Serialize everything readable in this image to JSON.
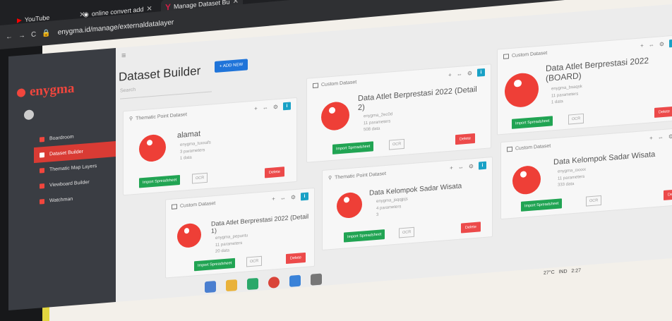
{
  "browser": {
    "tabs": [
      {
        "label": "YouTube"
      },
      {
        "label": "online convert add"
      },
      {
        "label": "Manage Dataset Bu"
      }
    ],
    "url": "enygma.id/manage/externaldatalayer"
  },
  "app": {
    "logo": "enygma",
    "sidebar": {
      "items": [
        {
          "label": "Boardroom"
        },
        {
          "label": "Dataset Builder"
        },
        {
          "label": "Thematic Map Layers"
        },
        {
          "label": "Viewboard Builder"
        },
        {
          "label": "Watchman"
        }
      ]
    },
    "page_title": "Dataset Builder",
    "add_new": "+ ADD NEW",
    "search_placeholder": "Search",
    "cards": [
      {
        "type": "Thematic Point Dataset",
        "name": "alamat",
        "m1": "enygma_tuxxafs",
        "m2": "3 parameters",
        "m3": "1 data",
        "import": "Import Spreadsheet",
        "ocr": "OCR",
        "delete": "Delete"
      },
      {
        "type": "Custom Dataset",
        "name": "Data Atlet Berprestasi 2022 (Detail 2)",
        "m1": "enygma_2ec0d",
        "m2": "11 parameters",
        "m3": "508 data",
        "import": "Import Spreadsheet",
        "ocr": "OCR",
        "delete": "Delete"
      },
      {
        "type": "Custom Dataset",
        "name": "Data Atlet Berprestasi 2022 (BOARD)",
        "m1": "enygma_bsaqsk",
        "m2": "11 parameters",
        "m3": "1 data",
        "import": "Import Spreadsheet",
        "ocr": "OCR",
        "delete": "Delete"
      },
      {
        "type": "Custom Dataset",
        "name": "Data Atlet Berprestasi 2022 (Detail 1)",
        "m1": "enygma_pepuntu",
        "m2": "11 parameters",
        "m3": "20 data",
        "import": "Import Spreadsheet",
        "ocr": "OCR",
        "delete": "Delete"
      },
      {
        "type": "Thematic Point Dataset",
        "name": "Data Kelompok Sadar Wisata",
        "m1": "enygma_jsqqjpjs",
        "m2": "4 parameters",
        "m3": "3",
        "import": "Import Spreadsheet",
        "ocr": "OCR",
        "delete": "Delete"
      },
      {
        "type": "Custom Dataset",
        "name": "Data Kelompok Sadar Wisata",
        "m1": "enygma_oxxxx",
        "m2": "11 parameters",
        "m3": "333 data",
        "import": "Import Spreadsheet",
        "ocr": "OCR",
        "delete": "Delete"
      }
    ]
  },
  "taskbar": {
    "weather": "27°C",
    "lang": "IND",
    "time": "2:27"
  },
  "colors": {
    "accent": "#ee3f37",
    "primary": "#1f74d9",
    "success": "#21a453",
    "info": "#19a1c6"
  }
}
